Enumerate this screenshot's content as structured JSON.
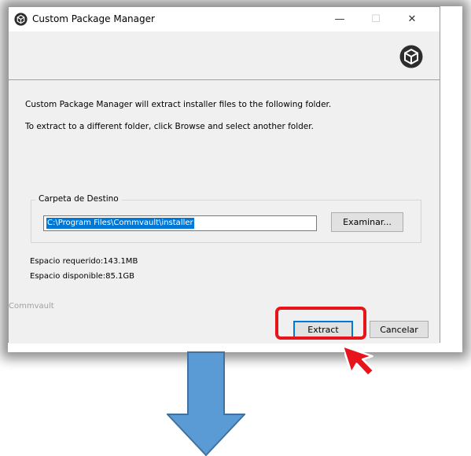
{
  "window": {
    "title": "Custom Package Manager",
    "controls": {
      "minimize": "—",
      "maximize": "☐",
      "close": "✕"
    }
  },
  "content": {
    "message_line1": "Custom Package Manager will extract installer files to the following folder.",
    "message_line2": "To extract to a different folder, click Browse and select another folder.",
    "destination_group_label": "Carpeta de Destino",
    "destination_path": "C:\\Program Files\\Commvault\\installer",
    "browse_label": "Examinar...",
    "space_required": "Espacio requerido:143.1MB",
    "space_available": "Espacio disponible:85.1GB",
    "brand": "Commvault"
  },
  "buttons": {
    "extract_label": "Extract",
    "cancel_label": "Cancelar"
  },
  "annotations": {
    "highlight_color": "#e8141b",
    "arrow_color": "#5b9bd5"
  },
  "icons": [
    "app-cube-icon",
    "commvault-logo-icon",
    "mouse-cursor-icon",
    "down-arrow-icon"
  ]
}
